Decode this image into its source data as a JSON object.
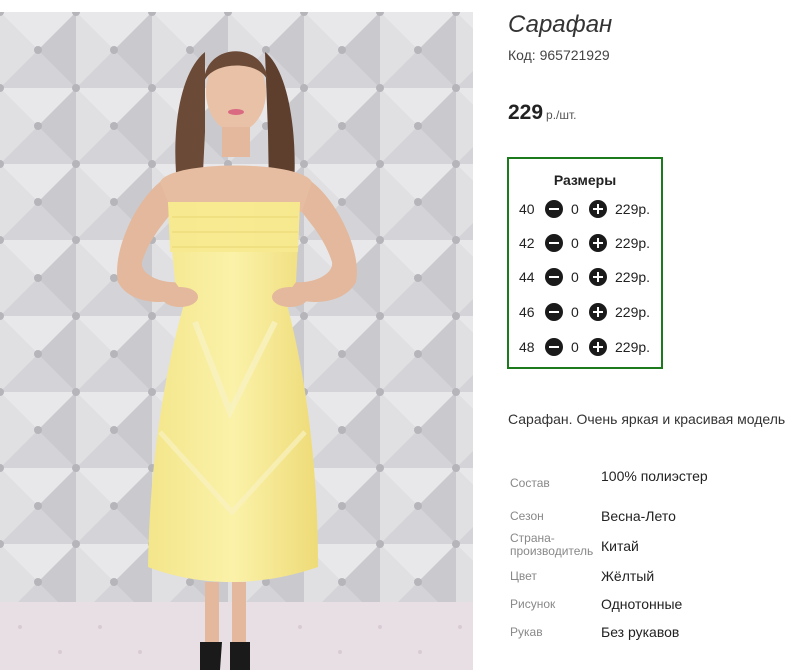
{
  "product": {
    "title": "Сарафан",
    "code_text": "Код: 965721929",
    "price_amount": "229",
    "price_unit": "р./шт.",
    "description": "Сарафан. Очень яркая и красивая модель",
    "photo_icon": "product-photo-woman-yellow-dress"
  },
  "sizes": {
    "title": "Размеры",
    "border_color": "#1c7a1c",
    "rows": [
      {
        "size": "40",
        "qty": "0",
        "price": "229р."
      },
      {
        "size": "42",
        "qty": "0",
        "price": "229р."
      },
      {
        "size": "44",
        "qty": "0",
        "price": "229р."
      },
      {
        "size": "46",
        "qty": "0",
        "price": "229р."
      },
      {
        "size": "48",
        "qty": "0",
        "price": "229р."
      }
    ]
  },
  "attributes": [
    {
      "key": "Состав",
      "value": "100% полиэстер"
    },
    {
      "key": "Сезон",
      "value": "Весна-Лето"
    },
    {
      "key": "Страна-производитель",
      "value": "Китай"
    },
    {
      "key": "Цвет",
      "value": "Жёлтый"
    },
    {
      "key": "Рисунок",
      "value": "Однотонные"
    },
    {
      "key": "Рукав",
      "value": "Без рукавов"
    }
  ]
}
